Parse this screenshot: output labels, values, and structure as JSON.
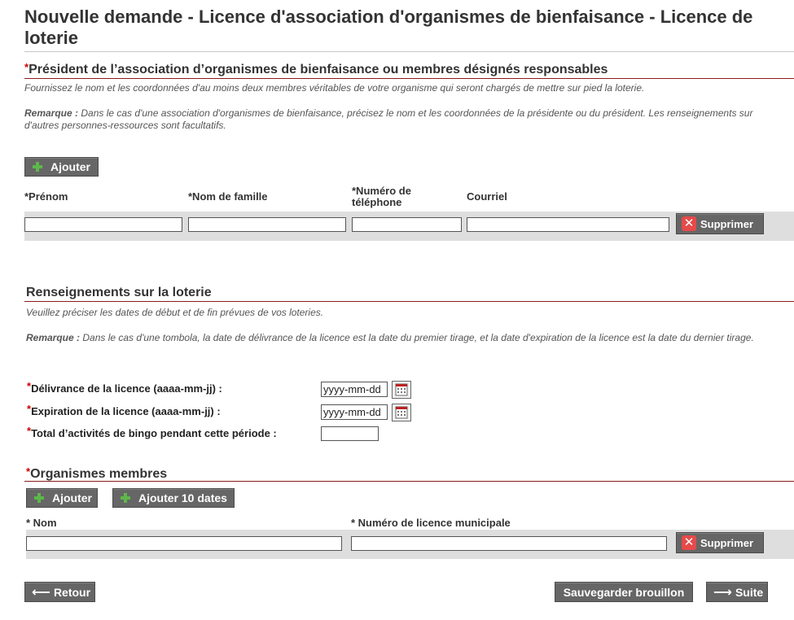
{
  "header": {
    "title": "Nouvelle demande - Licence d'association d'organismes de bienfaisance - Licence de loterie"
  },
  "section1": {
    "title": "Président de l’association d’organismes de bienfaisance ou membres désignés responsables",
    "desc": "Fournissez le nom et les coordonnées d'au moins deux membres véritables de votre organisme qui seront chargés de mettre sur pied la loterie.",
    "remark_label": "Remarque :",
    "remark": " Dans le cas d'une association d'organismes de bienfaisance, précisez le nom et les coordonnées de la présidente ou du président. Les renseignements sur d'autres personnes-ressources sont facultatifs.",
    "add_label": "Ajouter",
    "columns": {
      "first": "*Prénom",
      "last": "*Nom de famille",
      "phone": "*Numéro de téléphone",
      "email": "Courriel"
    },
    "delete_label": "Supprimer"
  },
  "section2": {
    "title": "Renseignements sur la loterie",
    "desc": "Veuillez préciser les dates de début et de fin prévues de vos loteries.",
    "remark_label": "Remarque :",
    "remark": " Dans le cas d'une tombola, la date de délivrance de la licence est la date du premier tirage, et la date d'expiration de la licence est la date du dernier tirage.",
    "issue_label": "Délivrance de la licence (aaaa-mm-jj) :",
    "issue_value": "yyyy-mm-dd",
    "expiry_label": "Expiration de la licence (aaaa-mm-jj) :",
    "expiry_value": "yyyy-mm-dd",
    "bingo_label": "Total d’activités de bingo pendant cette période :"
  },
  "section3": {
    "title": "Organismes membres",
    "add_label": "Ajouter",
    "add10_label": "Ajouter 10 dates",
    "columns": {
      "name": "* Nom",
      "licence": "* Numéro de licence municipale"
    },
    "delete_label": "Supprimer"
  },
  "footer": {
    "back": "Retour",
    "save": "Sauvegarder brouillon",
    "next": "Suite"
  }
}
